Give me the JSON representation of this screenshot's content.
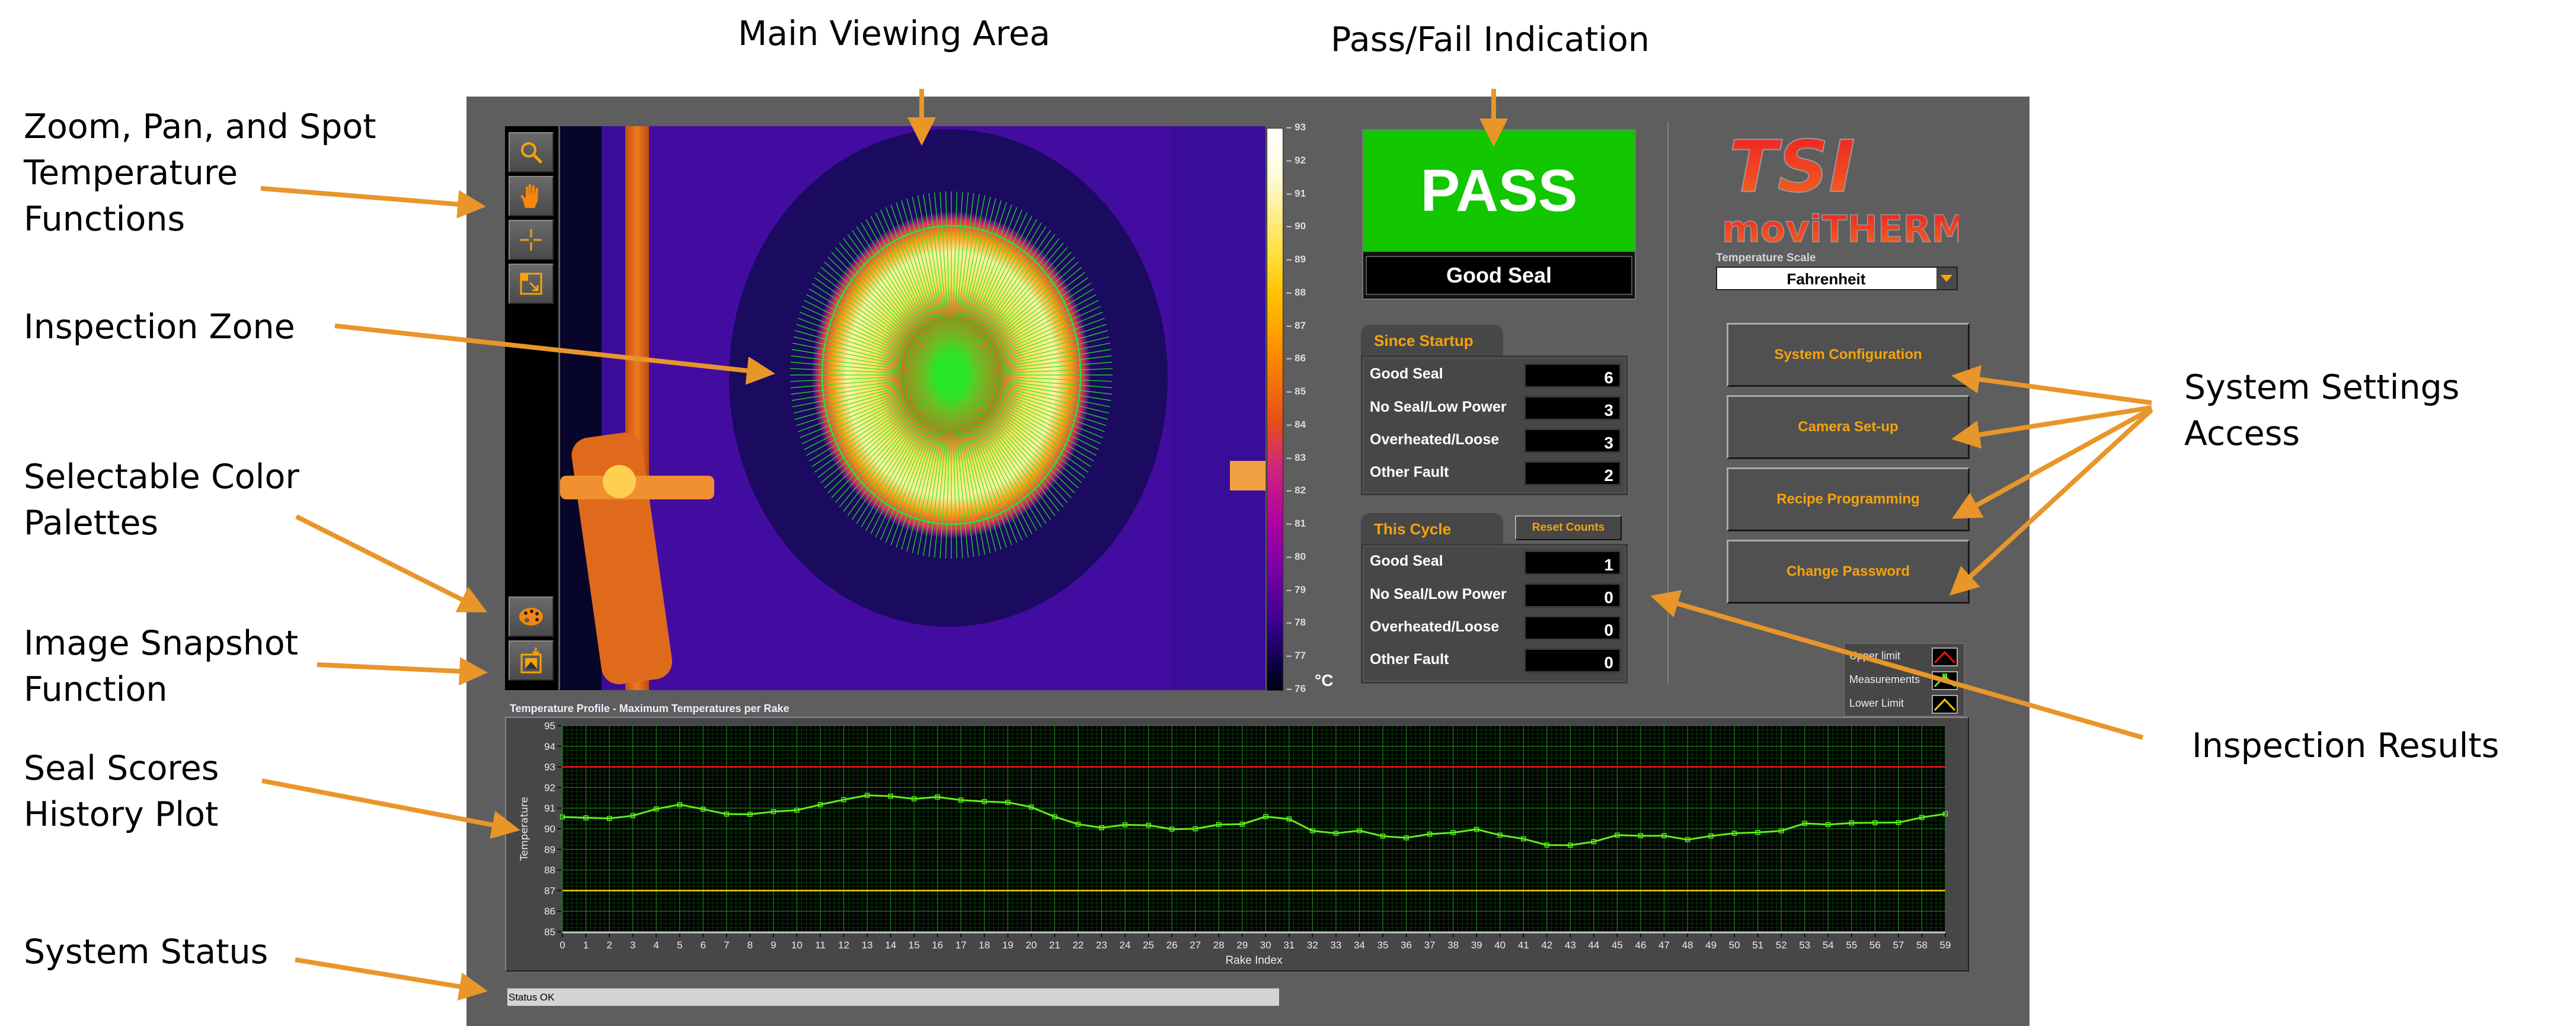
{
  "annotations": {
    "main_viewing_area": "Main Viewing Area",
    "pass_fail": "Pass/Fail Indication",
    "zoom_pan": "Zoom, Pan, and Spot\nTemperature\nFunctions",
    "inspection_zone": "Inspection Zone",
    "color_palettes": "Selectable Color\nPalettes",
    "snapshot": "Image Snapshot\nFunction",
    "seal_scores": "Seal Scores\nHistory Plot",
    "system_status": "System Status",
    "system_settings": "System Settings\nAccess",
    "inspection_results": "Inspection Results",
    "arrow_color": "#e8962a"
  },
  "toolbar": {
    "tools": [
      {
        "name": "zoom-tool",
        "icon": "magnifier-icon"
      },
      {
        "name": "pan-tool",
        "icon": "hand-icon"
      },
      {
        "name": "spot-temperature-tool",
        "icon": "crosshair-icon"
      },
      {
        "name": "zoom-fit-tool",
        "icon": "zoom-fit-icon"
      }
    ],
    "bottom_tools": [
      {
        "name": "color-palette-tool",
        "icon": "palette-icon"
      },
      {
        "name": "snapshot-tool",
        "icon": "snapshot-icon"
      }
    ],
    "accent_color": "#f5a30e"
  },
  "thermal_view": {
    "rake_count": 60,
    "overlay_color": "#29e629"
  },
  "colorbar": {
    "ticks": [
      "93",
      "92",
      "91",
      "90",
      "89",
      "88",
      "87",
      "86",
      "85",
      "84",
      "83",
      "82",
      "81",
      "80",
      "79",
      "78",
      "77",
      "76"
    ],
    "min": 76,
    "max": 93,
    "unit": "°C"
  },
  "result": {
    "status": "PASS",
    "detail": "Good Seal",
    "color": "#12c600"
  },
  "since_startup": {
    "title": "Since Startup",
    "rows": [
      {
        "label": "Good Seal",
        "value": "6"
      },
      {
        "label": "No Seal/Low Power",
        "value": "3"
      },
      {
        "label": "Overheated/Loose",
        "value": "3"
      },
      {
        "label": "Other Fault",
        "value": "2"
      }
    ]
  },
  "this_cycle": {
    "title": "This Cycle",
    "reset_label": "Reset Counts",
    "rows": [
      {
        "label": "Good Seal",
        "value": "1"
      },
      {
        "label": "No Seal/Low Power",
        "value": "0"
      },
      {
        "label": "Overheated/Loose",
        "value": "0"
      },
      {
        "label": "Other Fault",
        "value": "0"
      }
    ]
  },
  "brand": {
    "logo_top": "TSI",
    "logo_bottom": "moviTHERM"
  },
  "temperature_scale": {
    "label": "Temperature Scale",
    "selected": "Fahrenheit"
  },
  "settings_buttons": [
    {
      "label": "System Configuration"
    },
    {
      "label": "Camera Set-up"
    },
    {
      "label": "Recipe Programming"
    },
    {
      "label": "Change Password"
    }
  ],
  "legend": {
    "items": [
      {
        "label": "Upper limit",
        "color": "#ff1010"
      },
      {
        "label": "Measurements",
        "color": "#5ef01a"
      },
      {
        "label": "Lower Limit",
        "color": "#ffd000"
      }
    ]
  },
  "status": {
    "text": "Status OK"
  },
  "chart_data": {
    "type": "line",
    "title": "Temperature Profile - Maximum Temperatures per Rake",
    "xlabel": "Rake Index",
    "ylabel": "Temperature",
    "xlim": [
      0,
      59
    ],
    "ylim": [
      85,
      95
    ],
    "x_ticks": [
      0,
      1,
      2,
      3,
      4,
      5,
      6,
      7,
      8,
      9,
      10,
      11,
      12,
      13,
      14,
      15,
      16,
      17,
      18,
      19,
      20,
      21,
      22,
      23,
      24,
      25,
      26,
      27,
      28,
      29,
      30,
      31,
      32,
      33,
      34,
      35,
      36,
      37,
      38,
      39,
      40,
      41,
      42,
      43,
      44,
      45,
      46,
      47,
      48,
      49,
      50,
      51,
      52,
      53,
      54,
      55,
      56,
      57,
      58,
      59
    ],
    "y_ticks": [
      85,
      86,
      87,
      88,
      89,
      90,
      91,
      92,
      93,
      94,
      95
    ],
    "grid": true,
    "series": [
      {
        "name": "Upper limit",
        "color": "#ff1010",
        "values": [
          93,
          93
        ]
      },
      {
        "name": "Measurements",
        "color": "#5ef01a",
        "values": [
          90.57,
          90.53,
          90.5,
          90.63,
          90.96,
          91.17,
          90.95,
          90.71,
          90.7,
          90.83,
          90.9,
          91.17,
          91.41,
          91.62,
          91.58,
          91.45,
          91.54,
          91.39,
          91.32,
          91.28,
          91.05,
          90.58,
          90.22,
          90.05,
          90.19,
          90.17,
          89.98,
          90.0,
          90.2,
          90.22,
          90.59,
          90.47,
          89.9,
          89.78,
          89.91,
          89.64,
          89.56,
          89.74,
          89.81,
          89.97,
          89.69,
          89.51,
          89.21,
          89.2,
          89.37,
          89.69,
          89.66,
          89.66,
          89.47,
          89.65,
          89.78,
          89.82,
          89.9,
          90.26,
          90.2,
          90.28,
          90.29,
          90.3,
          90.55,
          90.72
        ]
      },
      {
        "name": "Lower Limit",
        "color": "#ffd000",
        "values": [
          87,
          87
        ]
      }
    ],
    "legend_position": "top-right"
  }
}
